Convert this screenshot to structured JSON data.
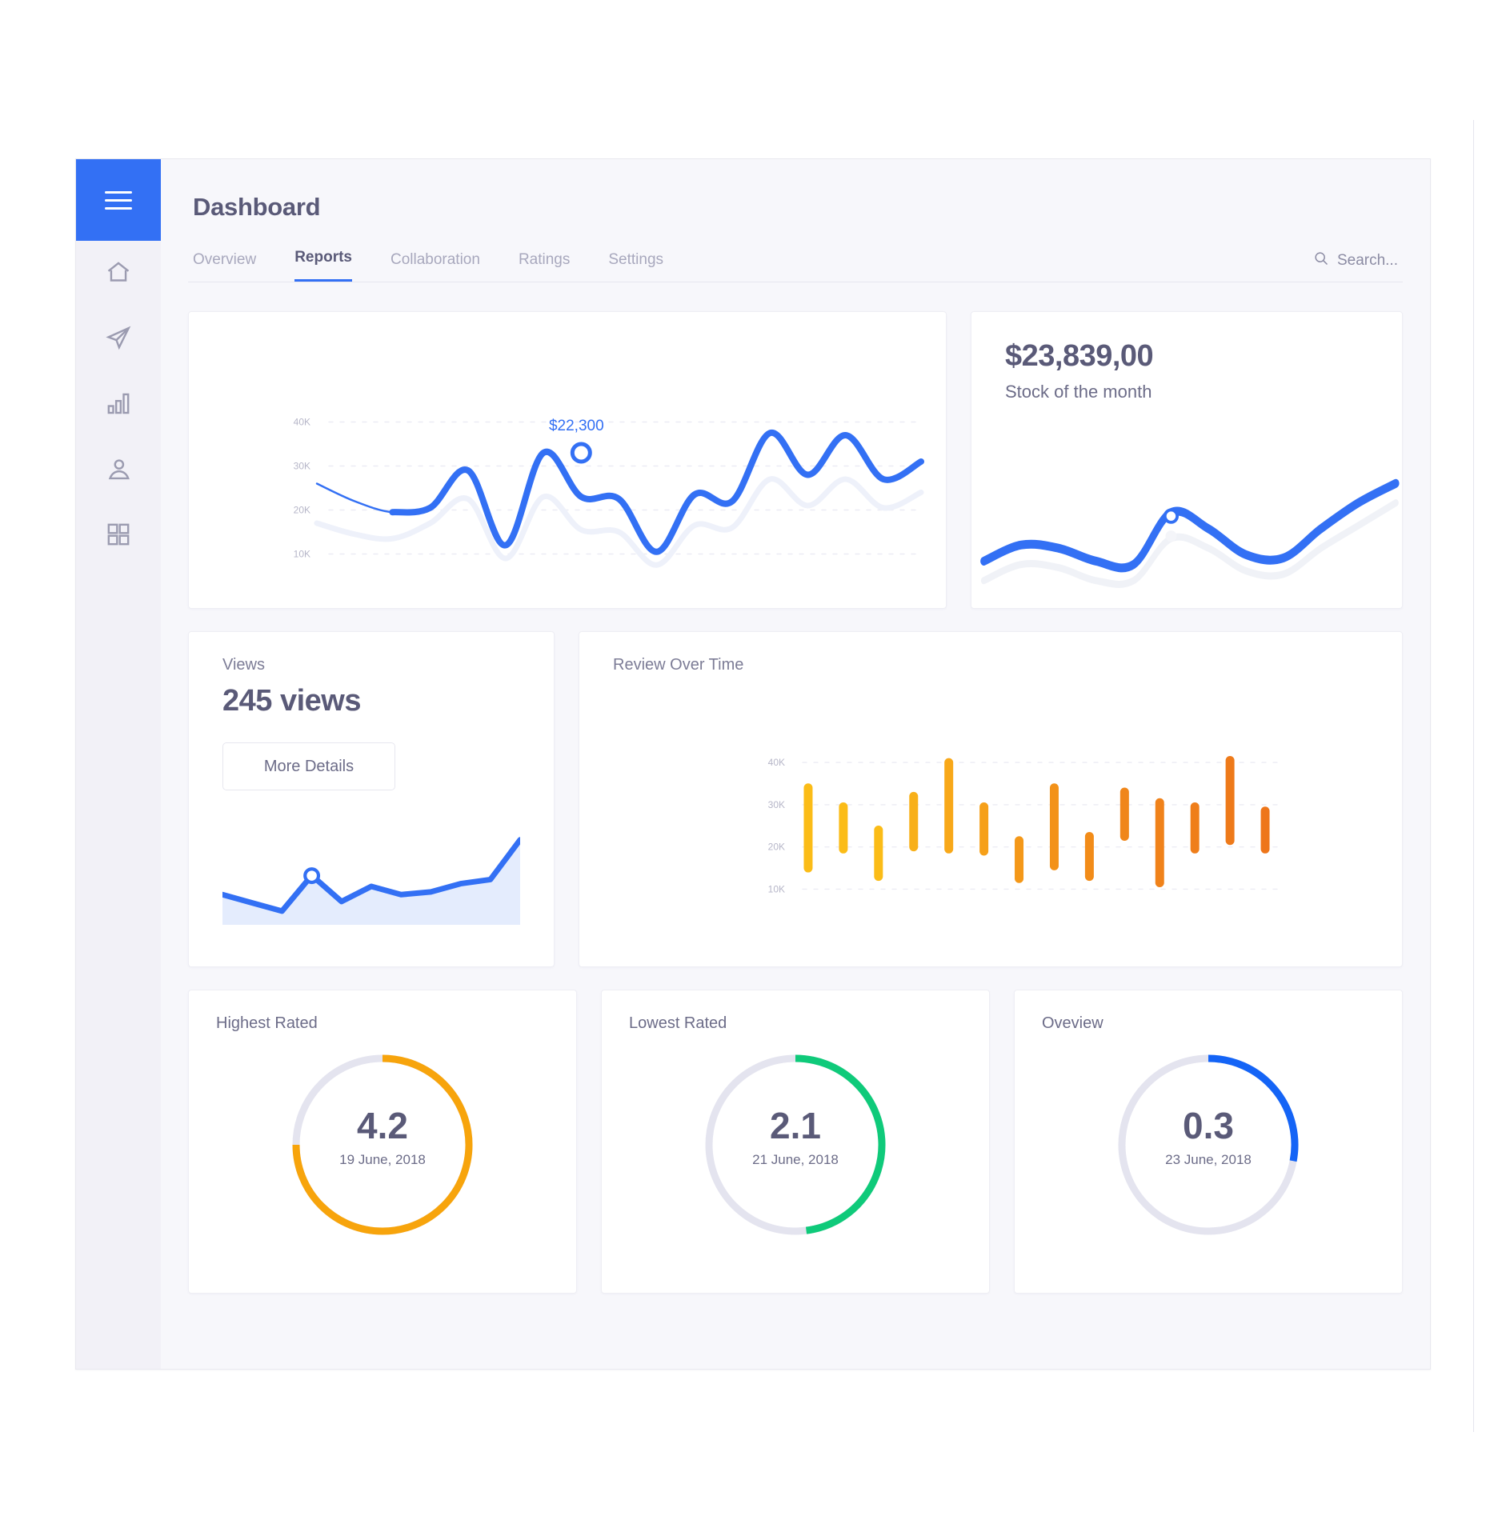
{
  "app": {
    "title": "Dashboard"
  },
  "sidebar": {
    "menu_icon": "hamburger-icon",
    "items": [
      {
        "icon": "home-icon",
        "name": "home"
      },
      {
        "icon": "send-icon",
        "name": "send"
      },
      {
        "icon": "bar-chart-icon",
        "name": "analytics"
      },
      {
        "icon": "user-icon",
        "name": "profile"
      },
      {
        "icon": "grid-icon",
        "name": "apps"
      }
    ],
    "active_color": "#3370f4"
  },
  "tabs": [
    {
      "label": "Overview",
      "active": false
    },
    {
      "label": "Reports",
      "active": true
    },
    {
      "label": "Collaboration",
      "active": false
    },
    {
      "label": "Ratings",
      "active": false
    },
    {
      "label": "Settings",
      "active": false
    }
  ],
  "search": {
    "placeholder": "Search...",
    "icon": "search-icon"
  },
  "stock_card": {
    "value": "$23,839,00",
    "label": "Stock of the month"
  },
  "views_card": {
    "label": "Views",
    "value": "245 views",
    "button_label": "More Details"
  },
  "review_card": {
    "title": "Review Over Time"
  },
  "gauges": [
    {
      "title": "Highest Rated",
      "value": "4.2",
      "date": "19 June, 2018",
      "color": "#f7a40c",
      "percent": 75
    },
    {
      "title": "Lowest Rated",
      "value": "2.1",
      "date": "21 June, 2018",
      "color": "#0fca7a",
      "percent": 48
    },
    {
      "title": "Oveview",
      "value": "0.3",
      "date": "23 June, 2018",
      "color": "#1464f6",
      "percent": 28
    }
  ],
  "colors": {
    "accent_blue": "#3370f4",
    "amber": "#fbbc17",
    "orange": "#f07c1b",
    "green": "#0fca7a",
    "track": "#e4e4ef",
    "text_dark": "#5a5a78",
    "text_muted": "#a8a8bd"
  },
  "chart_data": [
    {
      "id": "revenue-line",
      "type": "line",
      "title": "",
      "xlabel": "",
      "ylabel": "",
      "ylim": [
        5000,
        45000
      ],
      "yticks": [
        40000,
        30000,
        20000,
        10000
      ],
      "ytick_labels": [
        "40K",
        "30K",
        "20K",
        "10K"
      ],
      "grid": true,
      "annotation": {
        "label": "$22,300",
        "x_index": 7,
        "value": 33000
      },
      "series": [
        {
          "name": "current",
          "color": "#3370f4",
          "values": [
            26000,
            22000,
            19500,
            20500,
            29000,
            12000,
            33000,
            23000,
            22500,
            10500,
            23500,
            22000,
            37500,
            28000,
            37000,
            27000,
            31000
          ]
        },
        {
          "name": "previous",
          "color": "#eef1fa",
          "values": [
            17000,
            14500,
            13500,
            17000,
            22500,
            9000,
            23000,
            15500,
            15000,
            7500,
            16500,
            16000,
            27000,
            21000,
            27000,
            20500,
            24000
          ]
        }
      ]
    },
    {
      "id": "stock-sparkline",
      "type": "line",
      "title": "",
      "grid": false,
      "marker": {
        "x_index": 5,
        "value": 27
      },
      "series": [
        {
          "name": "stock",
          "color": "#3370f4",
          "values": [
            12,
            17,
            16,
            12,
            11,
            27,
            22,
            14,
            13,
            22,
            30,
            36
          ]
        },
        {
          "name": "stock-shadow",
          "color": "#f0f2f7",
          "values": [
            6,
            11,
            10,
            6,
            6,
            19,
            16,
            9,
            8,
            16,
            23,
            30
          ]
        }
      ]
    },
    {
      "id": "views-area",
      "type": "area",
      "title": "",
      "grid": false,
      "marker": {
        "x_index": 3,
        "value": 46
      },
      "series": [
        {
          "name": "views",
          "color": "#3370f4",
          "fill": "#e4ecfd",
          "values": [
            32,
            26,
            20,
            46,
            27,
            38,
            32,
            34,
            40,
            43,
            72
          ]
        }
      ]
    },
    {
      "id": "review-range-bars",
      "type": "bar",
      "title": "Review Over Time",
      "xlabel": "",
      "ylabel": "",
      "ylim": [
        8000,
        44000
      ],
      "yticks": [
        40000,
        30000,
        20000,
        10000
      ],
      "ytick_labels": [
        "40K",
        "30K",
        "20K",
        "10K"
      ],
      "grid": true,
      "bar_style": "floating-range",
      "bars": [
        {
          "low": 15000,
          "high": 34000,
          "color": "#fbbc17"
        },
        {
          "low": 19500,
          "high": 29500,
          "color": "#fbbc17"
        },
        {
          "low": 13000,
          "high": 24000,
          "color": "#fbbc17"
        },
        {
          "low": 20000,
          "high": 32000,
          "color": "#f8b019"
        },
        {
          "low": 19500,
          "high": 40000,
          "color": "#f8a819"
        },
        {
          "low": 19000,
          "high": 29500,
          "color": "#f6a019"
        },
        {
          "low": 12500,
          "high": 21500,
          "color": "#f49819"
        },
        {
          "low": 15500,
          "high": 34000,
          "color": "#f39219"
        },
        {
          "low": 13000,
          "high": 22500,
          "color": "#f28c19"
        },
        {
          "low": 22500,
          "high": 33000,
          "color": "#f0861a"
        },
        {
          "low": 11500,
          "high": 30500,
          "color": "#f0821a"
        },
        {
          "low": 19500,
          "high": 29500,
          "color": "#ef7e1a"
        },
        {
          "low": 21500,
          "high": 40500,
          "color": "#ee7a1a"
        },
        {
          "low": 19500,
          "high": 28500,
          "color": "#ee761a"
        }
      ]
    }
  ]
}
